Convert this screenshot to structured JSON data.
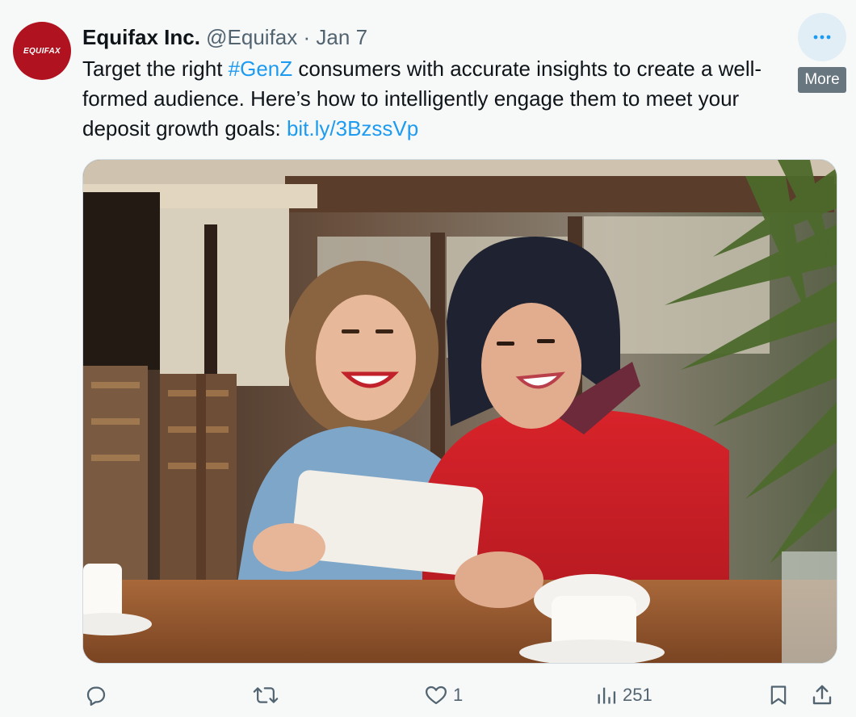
{
  "tweet": {
    "author": {
      "name": "Equifax Inc.",
      "handle": "@Equifax",
      "separator": "·",
      "date": "Jan 7",
      "avatar_text": "EQUIFAX"
    },
    "text": {
      "part1": "Target the right ",
      "hashtag": "#GenZ",
      "part2": " consumers with accurate insights to create a well-formed audience. Here’s how to intelligently engage them to meet your deposit growth goals: ",
      "link": "bit.ly/3BzssVp"
    },
    "more_tooltip": "More",
    "media": {
      "icon": "photo"
    },
    "actions": {
      "reply_count": "",
      "retweet_count": "",
      "like_count": "1",
      "views_count": "251"
    }
  },
  "colors": {
    "link": "#1d9bf0",
    "meta": "#536471",
    "avatar_bg": "#b1121f",
    "background": "#f7f9f9"
  },
  "icons": [
    "more-icon",
    "reply-icon",
    "retweet-icon",
    "like-icon",
    "views-icon",
    "bookmark-icon",
    "share-icon"
  ]
}
